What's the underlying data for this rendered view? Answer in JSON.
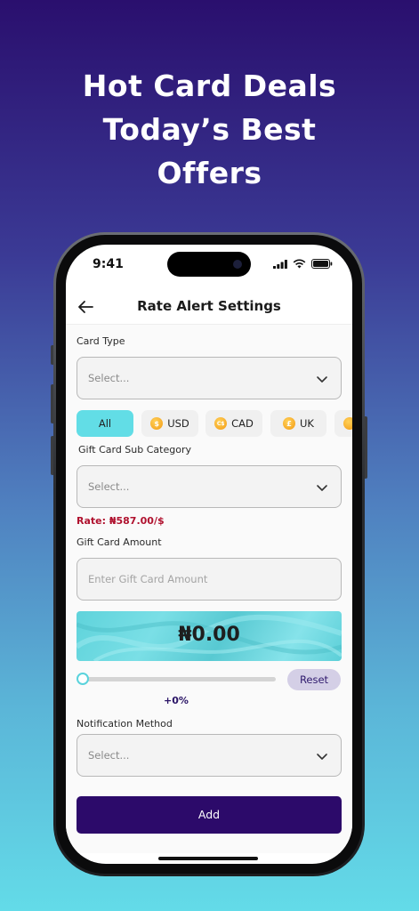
{
  "headline": [
    "Hot Card Deals",
    "Today’s Best",
    "Offers"
  ],
  "status_bar": {
    "time": "9:41"
  },
  "nav": {
    "title": "Rate Alert Settings"
  },
  "card_type": {
    "label": "Card Type",
    "placeholder": "Select..."
  },
  "currency_chips": [
    {
      "label": "All",
      "active": true
    },
    {
      "label": "USD",
      "icon": "dollar-coin-icon",
      "symbol": "$"
    },
    {
      "label": "CAD",
      "icon": "cad-coin-icon",
      "symbol": "C$"
    },
    {
      "label": "UK",
      "icon": "pound-coin-icon",
      "symbol": "£"
    }
  ],
  "sub_category": {
    "label": "Gift Card Sub Category",
    "placeholder": "Select..."
  },
  "rate": {
    "text": "Rate: ₦587.00/$"
  },
  "gift_card_amount": {
    "label": "Gift Card Amount",
    "placeholder": "Enter Gift Card Amount"
  },
  "amount_display": {
    "value": "₦0.00"
  },
  "slider": {
    "value_percent": 0,
    "reset_label": "Reset",
    "percent_text": "+0%"
  },
  "notification": {
    "label": "Notification Method",
    "placeholder": "Select..."
  },
  "add_button": {
    "label": "Add"
  },
  "colors": {
    "accent_cyan": "#62dde6",
    "primary_purple": "#2c0a6a",
    "rate_red": "#b0122f",
    "coin_gold": "#f39a12"
  }
}
